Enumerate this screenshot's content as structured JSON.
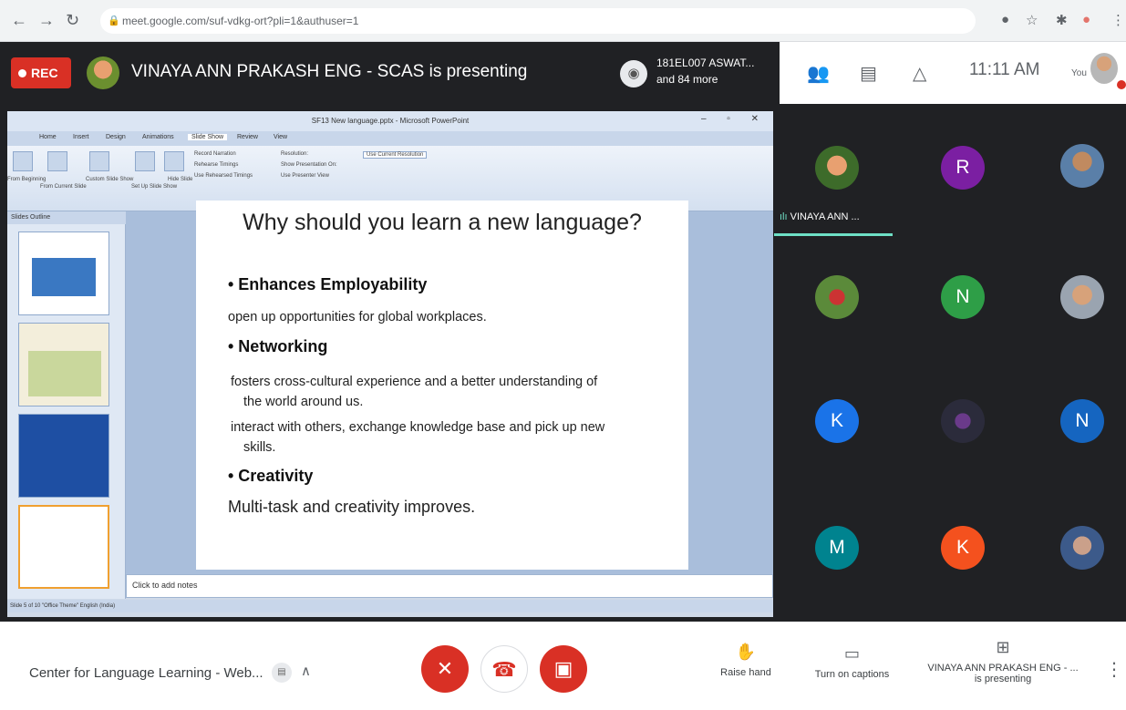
{
  "browser": {
    "url": "meet.google.com/suf-vdkg-ort?pli=1&authuser=1",
    "back_icon": "arrow-left-icon",
    "forward_icon": "arrow-right-icon",
    "reload_icon": "reload-icon"
  },
  "topbar": {
    "rec_label": "REC",
    "presenter_text": "VINAYA ANN PRAKASH ENG - SCAS is presenting",
    "participants_line1": "181EL007 ASWAT...",
    "participants_line2": "and 84 more",
    "time": "11:11 AM",
    "you_label": "You"
  },
  "powerpoint": {
    "window_title": "SF13 New language.pptx - Microsoft PowerPoint",
    "tabs": [
      "Home",
      "Insert",
      "Design",
      "Animations",
      "Slide Show",
      "Review",
      "View"
    ],
    "ribbon_labels": [
      "From Beginning",
      "From Current Slide",
      "Custom Slide Show",
      "Set Up Slide Show",
      "Hide Slide",
      "Record Narration",
      "Rehearse Timings",
      "Use Rehearsed Timings",
      "Resolution:",
      "Use Current Resolution",
      "Show Presentation On:",
      "Use Presenter View"
    ],
    "pane_tabs": "Slides   Outline",
    "notes_placeholder": "Click to add notes",
    "status_text": "Slide 5 of 10   \"Office Theme\"   English (India)"
  },
  "slide": {
    "title": "Why should you learn a new language?",
    "h1": "• Enhances Employability",
    "t1": "open up opportunities for global workplaces.",
    "h2": "• Networking",
    "t2a": "fosters cross-cultural experience and a better understanding of",
    "t2b": "the world around us.",
    "t3a": "interact with others, exchange knowledge base and pick up new",
    "t3b": "skills.",
    "h3": "• Creativity",
    "t4": "Multi-task  and creativity improves."
  },
  "participants": {
    "speaker_label": "VINAYA ANN ...",
    "tiles": [
      {
        "initial": "R",
        "color": "#7b1fa2"
      },
      {
        "initial": "N",
        "color": "#2e9e47"
      },
      {
        "initial": "K",
        "color": "#1a73e8"
      },
      {
        "initial": "N",
        "color": "#1565c0"
      },
      {
        "initial": "M",
        "color": "#00838f"
      },
      {
        "initial": "K",
        "color": "#f4511e"
      }
    ]
  },
  "bottombar": {
    "meeting_title": "Center for Language Learning - Web...",
    "raise_hand": "Raise hand",
    "captions": "Turn on captions",
    "presenting_line1": "VINAYA ANN PRAKASH ENG - ...",
    "presenting_line2": "is presenting",
    "mic_icon": "mic-off-icon",
    "leave_icon": "phone-hangup-icon",
    "camera_icon": "camera-off-icon"
  }
}
